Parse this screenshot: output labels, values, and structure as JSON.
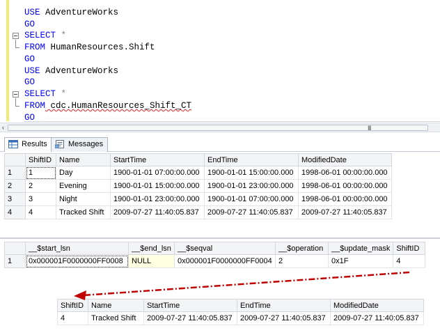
{
  "editor": {
    "lines": [
      {
        "kw": "USE",
        "rest": " AdventureWorks",
        "rest_kind": "ident"
      },
      {
        "kw": "GO",
        "rest": "",
        "rest_kind": "ident"
      },
      {
        "kw": "SELECT",
        "rest": " *",
        "rest_kind": "op"
      },
      {
        "kw": "FROM",
        "rest": " HumanResources.Shift",
        "rest_kind": "ident"
      },
      {
        "kw": "GO",
        "rest": "",
        "rest_kind": "ident"
      },
      {
        "kw": "USE",
        "rest": " AdventureWorks",
        "rest_kind": "ident"
      },
      {
        "kw": "GO",
        "rest": "",
        "rest_kind": "ident"
      },
      {
        "kw": "SELECT",
        "rest": " *",
        "rest_kind": "op"
      },
      {
        "kw": "FROM",
        "rest": " cdc.HumanResources_Shift_CT",
        "rest_kind": "ident"
      },
      {
        "kw": "GO",
        "rest": "",
        "rest_kind": "ident"
      }
    ]
  },
  "scrollbar": {
    "left_arrow": "‹",
    "grip": "III"
  },
  "tabs": [
    {
      "label": "Results",
      "icon": "grid-icon",
      "active": true
    },
    {
      "label": "Messages",
      "icon": "messages-icon",
      "active": false
    }
  ],
  "grid1": {
    "columns": [
      "",
      "ShiftID",
      "Name",
      "StartTime",
      "EndTime",
      "ModifiedDate"
    ],
    "rows": [
      [
        "1",
        "1",
        "Day",
        "1900-01-01 07:00:00.000",
        "1900-01-01 15:00:00.000",
        "1998-06-01 00:00:00.000"
      ],
      [
        "2",
        "2",
        "Evening",
        "1900-01-01 15:00:00.000",
        "1900-01-01 23:00:00.000",
        "1998-06-01 00:00:00.000"
      ],
      [
        "3",
        "3",
        "Night",
        "1900-01-01 23:00:00.000",
        "1900-01-01 07:00:00.000",
        "1998-06-01 00:00:00.000"
      ],
      [
        "4",
        "4",
        "Tracked Shift",
        "2009-07-27 11:40:05.837",
        "2009-07-27 11:40:05.837",
        "2009-07-27 11:40:05.837"
      ]
    ]
  },
  "grid2": {
    "columns": [
      "",
      "__$start_lsn",
      "__$end_lsn",
      "__$seqval",
      "__$operation",
      "__$update_mask",
      "ShiftID"
    ],
    "rows": [
      [
        "1",
        "0x000001F0000000FF0008",
        "NULL",
        "0x000001F0000000FF0004",
        "2",
        "0x1F",
        "4"
      ]
    ]
  },
  "grid3": {
    "columns": [
      "ShiftID",
      "Name",
      "StartTime",
      "EndTime",
      "ModifiedDate"
    ],
    "rows": [
      [
        "4",
        "Tracked Shift",
        "2009-07-27 11:40:05.837",
        "2009-07-27 11:40:05.837",
        "2009-07-27 11:40:05.837"
      ]
    ]
  },
  "colors": {
    "keyword": "#0000ff",
    "change_bar": "#f2ea78",
    "arrow": "#c00000",
    "null_highlight": "#ffffe1"
  }
}
